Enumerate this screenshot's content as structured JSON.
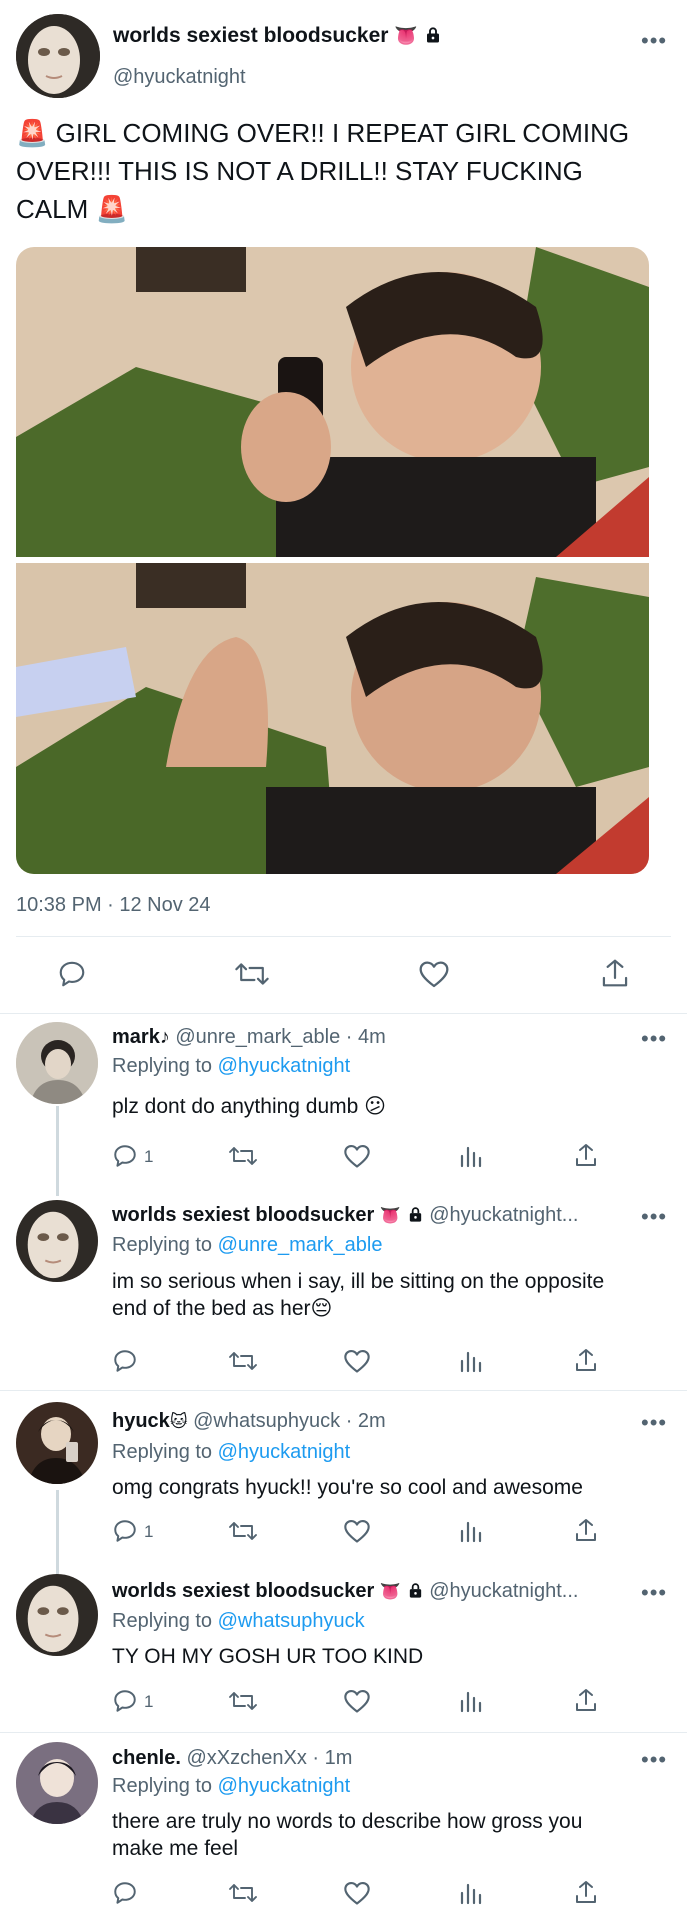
{
  "main_tweet": {
    "display_name": "worlds sexiest bloodsucker",
    "handle": "@hyuckatnight",
    "name_emojis": "👅",
    "text_line1": "🚨 GIRL COMING OVER!! I REPEAT GIRL COMING",
    "text_line2": "OVER!!! THIS IS NOT A DRILL!! STAY FUCKING",
    "text_line3": "CALM 🚨",
    "timestamp": "10:38 PM · 12 Nov 24",
    "more": "•••"
  },
  "replies": [
    {
      "display_name": "mark♪",
      "handle_time": "@unre_mark_able · 4m",
      "replying_prefix": "Replying to",
      "replying_to": "@hyuckatnight",
      "text": "plz dont do anything dumb 😕",
      "reply_count": "1",
      "more": "•••"
    },
    {
      "display_name": "worlds sexiest bloodsucker",
      "name_emojis": "👅",
      "handle_time": "@hyuckatnight...",
      "replying_prefix": "Replying to",
      "replying_to": "@unre_mark_able",
      "text_line1": "im so serious when i say, ill be sitting on the opposite",
      "text_line2": "end of the bed as her😔",
      "reply_count": "",
      "more": "•••"
    },
    {
      "display_name": "hyuck",
      "name_emojis": "🐱",
      "handle_time": "@whatsuphyuck · 2m",
      "replying_prefix": "Replying to",
      "replying_to": "@hyuckatnight",
      "text": "omg congrats hyuck!! you're so cool and awesome",
      "reply_count": "1",
      "more": "•••"
    },
    {
      "display_name": "worlds sexiest bloodsucker",
      "name_emojis": "👅",
      "handle_time": "@hyuckatnight...",
      "replying_prefix": "Replying to",
      "replying_to": "@whatsuphyuck",
      "text": "TY OH MY GOSH UR TOO KIND",
      "reply_count": "1",
      "more": "•••"
    },
    {
      "display_name": "chenle.",
      "handle_time": "@xXzchenXx · 1m",
      "replying_prefix": "Replying to",
      "replying_to": "@hyuckatnight",
      "text_line1": "there are truly no words to describe how gross you",
      "text_line2": "make me feel",
      "reply_count": "",
      "more": "•••"
    }
  ],
  "icons": {
    "reply": "reply-icon",
    "retweet": "retweet-icon",
    "like": "like-icon",
    "views": "views-icon",
    "share": "share-icon",
    "lock": "lock-icon"
  },
  "colors": {
    "link": "#1d9bf0",
    "muted": "#536471",
    "divider": "#e6ecf0"
  }
}
